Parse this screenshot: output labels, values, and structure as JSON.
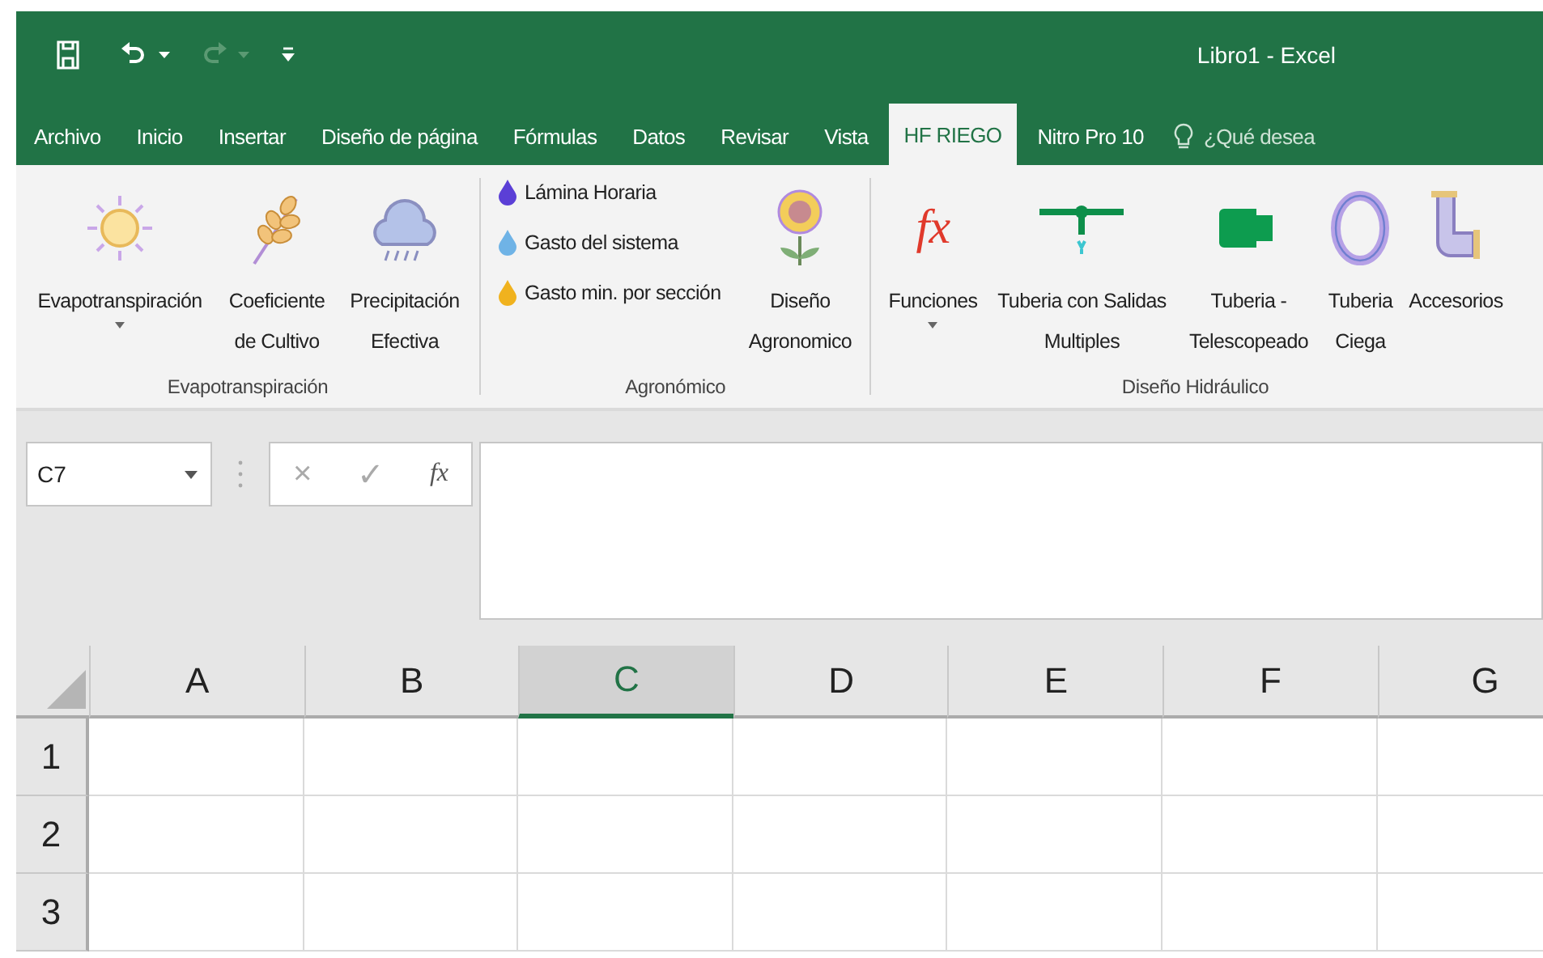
{
  "window": {
    "title": "Libro1 - Excel"
  },
  "tabs": [
    {
      "label": "Archivo",
      "selected": false
    },
    {
      "label": "Inicio",
      "selected": false
    },
    {
      "label": "Insertar",
      "selected": false
    },
    {
      "label": "Diseño de página",
      "selected": false
    },
    {
      "label": "Fórmulas",
      "selected": false
    },
    {
      "label": "Datos",
      "selected": false
    },
    {
      "label": "Revisar",
      "selected": false
    },
    {
      "label": "Vista",
      "selected": false
    },
    {
      "label": "HF RIEGO",
      "selected": true
    },
    {
      "label": "Nitro Pro 10",
      "selected": false
    }
  ],
  "tell_me": {
    "placeholder": "¿Qué desea"
  },
  "ribbon": {
    "groups": [
      {
        "label": "Evapotranspiración",
        "items": [
          {
            "kind": "large",
            "label": "Evapotranspiración",
            "dropdown": true
          },
          {
            "kind": "large",
            "label": "Coeficiente de Cultivo",
            "dropdown": false
          },
          {
            "kind": "large",
            "label": "Precipitación Efectiva",
            "dropdown": false
          }
        ]
      },
      {
        "label": "Agronómico",
        "items": [
          {
            "kind": "small",
            "label": "Lámina Horaria",
            "color": "#5b3fd6"
          },
          {
            "kind": "small",
            "label": "Gasto del sistema",
            "color": "#6fb3e6"
          },
          {
            "kind": "small",
            "label": "Gasto min. por sección",
            "color": "#f0b21e"
          },
          {
            "kind": "large",
            "label": "Diseño Agronomico",
            "dropdown": false
          }
        ]
      },
      {
        "label": "Diseño Hidráulico",
        "items": [
          {
            "kind": "glyph",
            "glyph": "fx",
            "label": "Funciones",
            "dropdown": true
          },
          {
            "kind": "large",
            "label": "Tuberia con Salidas Multiples",
            "dropdown": false
          },
          {
            "kind": "large",
            "label": "Tuberia - Telescopeado",
            "dropdown": false
          },
          {
            "kind": "large",
            "label": "Tuberia Ciega",
            "dropdown": false
          },
          {
            "kind": "large",
            "label": "Accesorios",
            "dropdown": false
          }
        ]
      }
    ]
  },
  "name_box": {
    "value": "C7"
  },
  "formula_buttons": [
    "×",
    "✓",
    "fx"
  ],
  "columns": [
    {
      "label": "A",
      "selected": false
    },
    {
      "label": "B",
      "selected": false
    },
    {
      "label": "C",
      "selected": true
    },
    {
      "label": "D",
      "selected": false
    },
    {
      "label": "E",
      "selected": false
    },
    {
      "label": "F",
      "selected": false
    },
    {
      "label": "G",
      "selected": false
    }
  ],
  "rows": [
    {
      "label": "1"
    },
    {
      "label": "2"
    },
    {
      "label": "3"
    }
  ]
}
